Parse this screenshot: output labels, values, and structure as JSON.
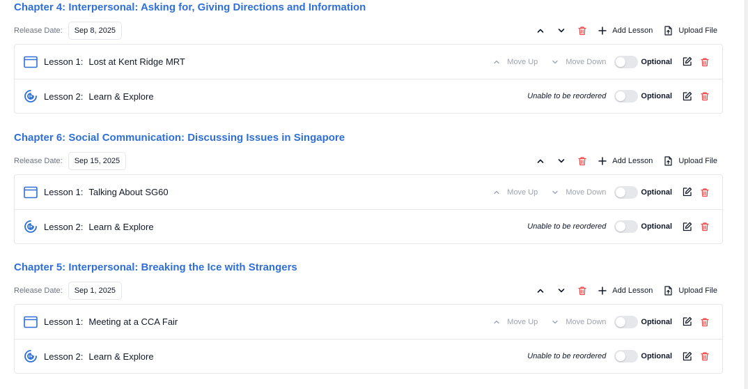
{
  "labels": {
    "release_date": "Release Date:",
    "add_lesson": "Add Lesson",
    "upload_file": "Upload File",
    "move_up": "Move Up",
    "move_down": "Move Down",
    "optional": "Optional",
    "unable_reorder": "Unable to be reordered"
  },
  "colors": {
    "accent": "#2f6fd6",
    "danger": "#ef4444",
    "muted": "#9ca3af"
  },
  "chapters": [
    {
      "title": "Chapter 4: Interpersonal: Asking for, Giving Directions and Information",
      "release_date": "Sep 8, 2025",
      "lessons": [
        {
          "number": "Lesson 1:",
          "title": "Lost at Kent Ridge MRT",
          "icon": "browser-window-icon",
          "reorderable": true,
          "optional": false
        },
        {
          "number": "Lesson 2:",
          "title": "Learn & Explore",
          "icon": "explore-gauge-icon",
          "reorderable": false,
          "optional": false
        }
      ]
    },
    {
      "title": "Chapter 6: Social Communication: Discussing Issues in Singapore",
      "release_date": "Sep 15, 2025",
      "lessons": [
        {
          "number": "Lesson 1:",
          "title": "Talking About SG60",
          "icon": "browser-window-icon",
          "reorderable": true,
          "optional": false
        },
        {
          "number": "Lesson 2:",
          "title": "Learn & Explore",
          "icon": "explore-gauge-icon",
          "reorderable": false,
          "optional": false
        }
      ]
    },
    {
      "title": "Chapter 5: Interpersonal: Breaking the Ice with Strangers",
      "release_date": "Sep 1, 2025",
      "lessons": [
        {
          "number": "Lesson 1:",
          "title": "Meeting at a CCA Fair",
          "icon": "browser-window-icon",
          "reorderable": true,
          "optional": false
        },
        {
          "number": "Lesson 2:",
          "title": "Learn & Explore",
          "icon": "explore-gauge-icon",
          "reorderable": false,
          "optional": false
        }
      ]
    }
  ]
}
